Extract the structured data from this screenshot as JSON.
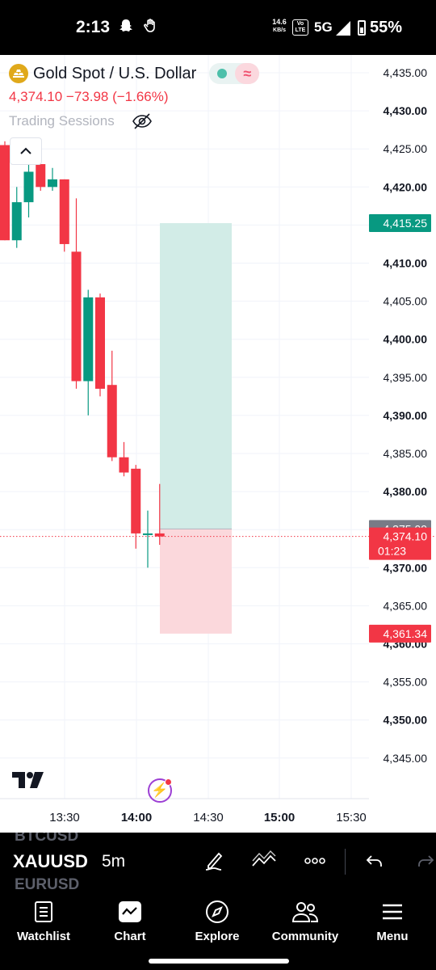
{
  "status_bar": {
    "time": "2:13",
    "net_speed_value": "14.6",
    "net_speed_unit": "KB/s",
    "lte_top": "Vo",
    "lte_bottom": "LTE",
    "network": "5G",
    "battery": "55%"
  },
  "header": {
    "title": "Gold Spot / U.S. Dollar",
    "quote": "4,374.10  −73.98 (−1.66%)",
    "sessions_label": "Trading Sessions",
    "pill_right": "≈"
  },
  "colors": {
    "up": "#089981",
    "down": "#f23645",
    "target_zone": "#d2ece7",
    "stop_zone": "#fbd8dc",
    "grid": "#f0f3fa",
    "tv_logo": "#131722",
    "accent_purple": "#9c3fd4"
  },
  "price_axis": {
    "ticks": [
      {
        "v": 4435,
        "label": "4,435.00",
        "bold": false
      },
      {
        "v": 4430,
        "label": "4,430.00",
        "bold": true
      },
      {
        "v": 4425,
        "label": "4,425.00",
        "bold": false
      },
      {
        "v": 4420,
        "label": "4,420.00",
        "bold": true
      },
      {
        "v": 4415,
        "label": "4,415.00",
        "bold": false
      },
      {
        "v": 4410,
        "label": "4,410.00",
        "bold": true
      },
      {
        "v": 4405,
        "label": "4,405.00",
        "bold": false
      },
      {
        "v": 4400,
        "label": "4,400.00",
        "bold": true
      },
      {
        "v": 4395,
        "label": "4,395.00",
        "bold": false
      },
      {
        "v": 4390,
        "label": "4,390.00",
        "bold": true
      },
      {
        "v": 4385,
        "label": "4,385.00",
        "bold": false
      },
      {
        "v": 4380,
        "label": "4,380.00",
        "bold": true
      },
      {
        "v": 4375,
        "label": "4,375.00",
        "bold": false
      },
      {
        "v": 4370,
        "label": "4,370.00",
        "bold": true
      },
      {
        "v": 4365,
        "label": "4,365.00",
        "bold": false
      },
      {
        "v": 4360,
        "label": "4,360.00",
        "bold": true
      },
      {
        "v": 4355,
        "label": "4,355.00",
        "bold": false
      },
      {
        "v": 4350,
        "label": "4,350.00",
        "bold": true
      },
      {
        "v": 4345,
        "label": "4,345.00",
        "bold": false
      }
    ],
    "badges": [
      {
        "v": 4415.25,
        "label": "4,415.25",
        "color": "#089981"
      },
      {
        "v": 4375.09,
        "label": "4,375.09",
        "color": "#787b86"
      },
      {
        "v": 4374.1,
        "label": "4,374.10",
        "sub": "01:23",
        "color": "#f23645"
      },
      {
        "v": 4361.34,
        "label": "4,361.34",
        "color": "#f23645"
      }
    ]
  },
  "time_axis": [
    {
      "t": "13:30",
      "bold": false
    },
    {
      "t": "14:00",
      "bold": true
    },
    {
      "t": "14:30",
      "bold": false
    },
    {
      "t": "15:00",
      "bold": true
    },
    {
      "t": "15:30",
      "bold": false
    }
  ],
  "chart_data": {
    "type": "candlestick",
    "interval": "5m",
    "symbol": "XAUUSD",
    "last_price": 4374.1,
    "ylim": [
      4342,
      4437.5
    ],
    "candles": [
      {
        "o": 4425.5,
        "h": 4426,
        "l": 4413,
        "c": 4413
      },
      {
        "o": 4413,
        "h": 4420,
        "l": 4412,
        "c": 4418
      },
      {
        "o": 4418,
        "h": 4424,
        "l": 4416,
        "c": 4422
      },
      {
        "o": 4423,
        "h": 4423.5,
        "l": 4419.5,
        "c": 4420
      },
      {
        "o": 4420,
        "h": 4422.5,
        "l": 4419.5,
        "c": 4421
      },
      {
        "o": 4421,
        "h": 4421,
        "l": 4411.5,
        "c": 4412.5
      },
      {
        "o": 4411.5,
        "h": 4418.5,
        "l": 4393.5,
        "c": 4394.5
      },
      {
        "o": 4394.5,
        "h": 4406.5,
        "l": 4390,
        "c": 4405.5
      },
      {
        "o": 4405.5,
        "h": 4406,
        "l": 4392.5,
        "c": 4393.5
      },
      {
        "o": 4394,
        "h": 4398.5,
        "l": 4384,
        "c": 4384.5
      },
      {
        "o": 4384.5,
        "h": 4386.5,
        "l": 4382,
        "c": 4382.5
      },
      {
        "o": 4383,
        "h": 4383.5,
        "l": 4372.5,
        "c": 4374.5
      },
      {
        "o": 4374.5,
        "h": 4377.5,
        "l": 4370,
        "c": 4374.5
      },
      {
        "o": 4374.5,
        "h": 4381,
        "l": 4373,
        "c": 4374.1
      }
    ],
    "position_tool": {
      "entry": 4375.09,
      "target": 4415.25,
      "stop": 4361.34
    }
  },
  "toolbar": {
    "symbol_above": "BTCUSD",
    "symbol": "XAUUSD",
    "symbol_below": "EURUSD",
    "timeframe": "5m"
  },
  "nav": {
    "items": [
      {
        "label": "Watchlist"
      },
      {
        "label": "Chart"
      },
      {
        "label": "Explore"
      },
      {
        "label": "Community"
      },
      {
        "label": "Menu"
      }
    ]
  }
}
